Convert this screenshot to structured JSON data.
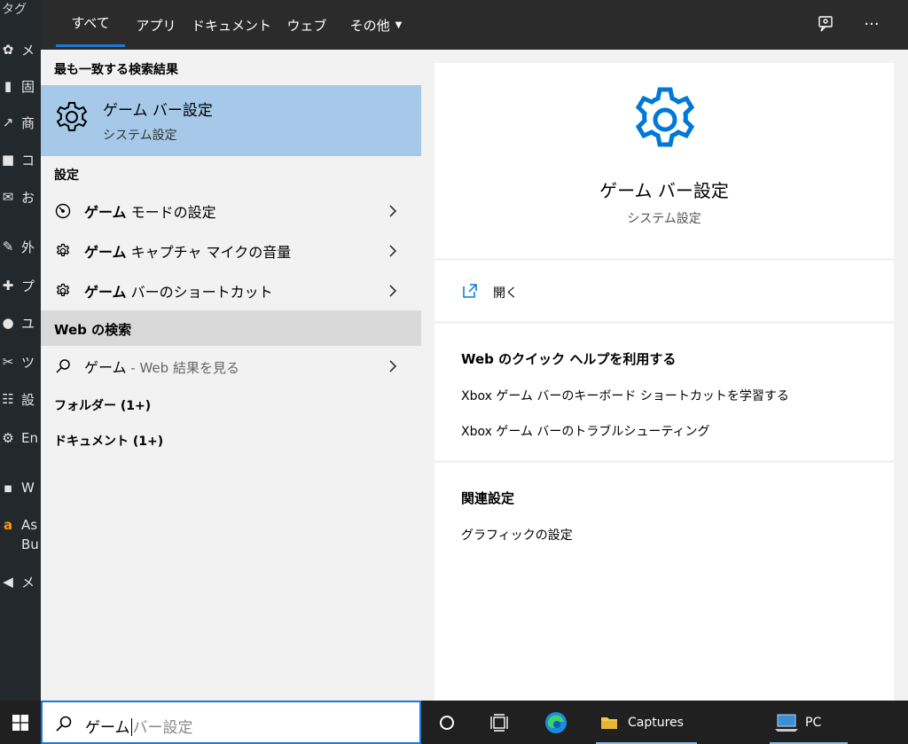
{
  "background_app": {
    "top_text": "タグ",
    "items": [
      "メ",
      "固",
      "商",
      "コ",
      "お",
      "外",
      "プ",
      "ユ",
      "ツ",
      "設",
      "En",
      "W",
      "As",
      "Bu",
      "メ"
    ]
  },
  "topbar": {
    "tabs": [
      {
        "label": "すべて",
        "active": true
      },
      {
        "label": "アプリ"
      },
      {
        "label": "ドキュメント"
      },
      {
        "label": "ウェブ"
      },
      {
        "label": "その他"
      }
    ],
    "feedback_icon": "feedback-icon",
    "more_icon": "more-icon",
    "accent_color": "#1e78d6"
  },
  "results": {
    "best_match_header": "最も一致する検索結果",
    "best_match": {
      "title": "ゲーム バー設定",
      "subtitle": "システム設定"
    },
    "settings_header": "設定",
    "settings_items": [
      {
        "bold": "ゲーム",
        "rest": " モードの設定",
        "icon": "gauge-icon"
      },
      {
        "bold": "ゲーム",
        "rest": " キャプチャ マイクの音量",
        "icon": "gear-icon"
      },
      {
        "bold": "ゲーム",
        "rest": " バーのショートカット",
        "icon": "gear-icon"
      }
    ],
    "web_header": "Web の検索",
    "web_item": {
      "query": "ゲーム",
      "hint": " - Web 結果を見る"
    },
    "folders": "フォルダー (1+)",
    "documents": "ドキュメント (1+)"
  },
  "preview": {
    "title": "ゲーム バー設定",
    "subtitle": "システム設定",
    "open_label": "開く",
    "help_header": "Web のクイック ヘルプを利用する",
    "help_links": [
      "Xbox ゲーム バーのキーボード ショートカットを学習する",
      "Xbox ゲーム バーのトラブルシューティング"
    ],
    "related_header": "関連設定",
    "related_links": [
      "グラフィックの設定"
    ],
    "icon_color": "#0078d7"
  },
  "taskbar": {
    "search_typed": "ゲーム",
    "search_ghost": "バー設定",
    "captures_label": "Captures",
    "pc_label": "PC"
  }
}
